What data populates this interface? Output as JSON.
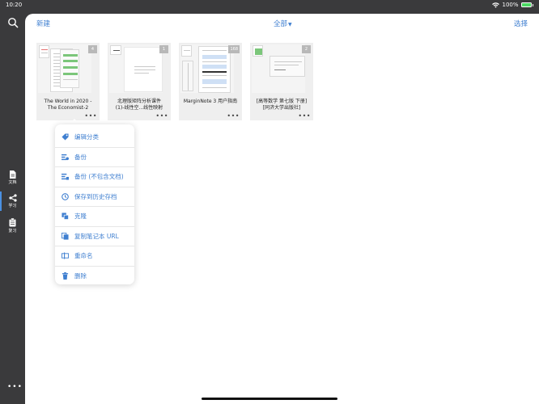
{
  "status": {
    "time": "10:20",
    "battery": "100%"
  },
  "sidebar": {
    "items": [
      {
        "label": "文档",
        "icon": "document-icon"
      },
      {
        "label": "学习",
        "icon": "mindmap-icon"
      },
      {
        "label": "复习",
        "icon": "review-icon"
      }
    ]
  },
  "topbar": {
    "new_label": "新建",
    "filter_label": "全部",
    "select_label": "选择"
  },
  "notebooks": [
    {
      "title": "The World in 2020 -\nThe Economist-2",
      "count": "4"
    },
    {
      "title": "北理版矩阵分析课件\n(1)-线性空...线性映射",
      "count": "1"
    },
    {
      "title": "MarginNote 3 用户指南",
      "count": "168"
    },
    {
      "title": "[高等数学 第七版 下册]\n[同济大学出版社]",
      "count": "2"
    }
  ],
  "menu": {
    "items": [
      {
        "label": "编辑分类",
        "icon": "tag-icon"
      },
      {
        "label": "备份",
        "icon": "backup-icon"
      },
      {
        "label": "备份 (不包含文档)",
        "icon": "backup-no-doc-icon"
      },
      {
        "label": "保存到历史存档",
        "icon": "history-icon"
      },
      {
        "label": "克隆",
        "icon": "clone-icon"
      },
      {
        "label": "复制笔记本 URL",
        "icon": "copy-url-icon"
      },
      {
        "label": "重命名",
        "icon": "rename-icon"
      },
      {
        "label": "删除",
        "icon": "trash-icon"
      }
    ]
  },
  "colors": {
    "accent": "#3f7fd0",
    "sidebar": "#3a3a3c",
    "card": "#efefef"
  }
}
